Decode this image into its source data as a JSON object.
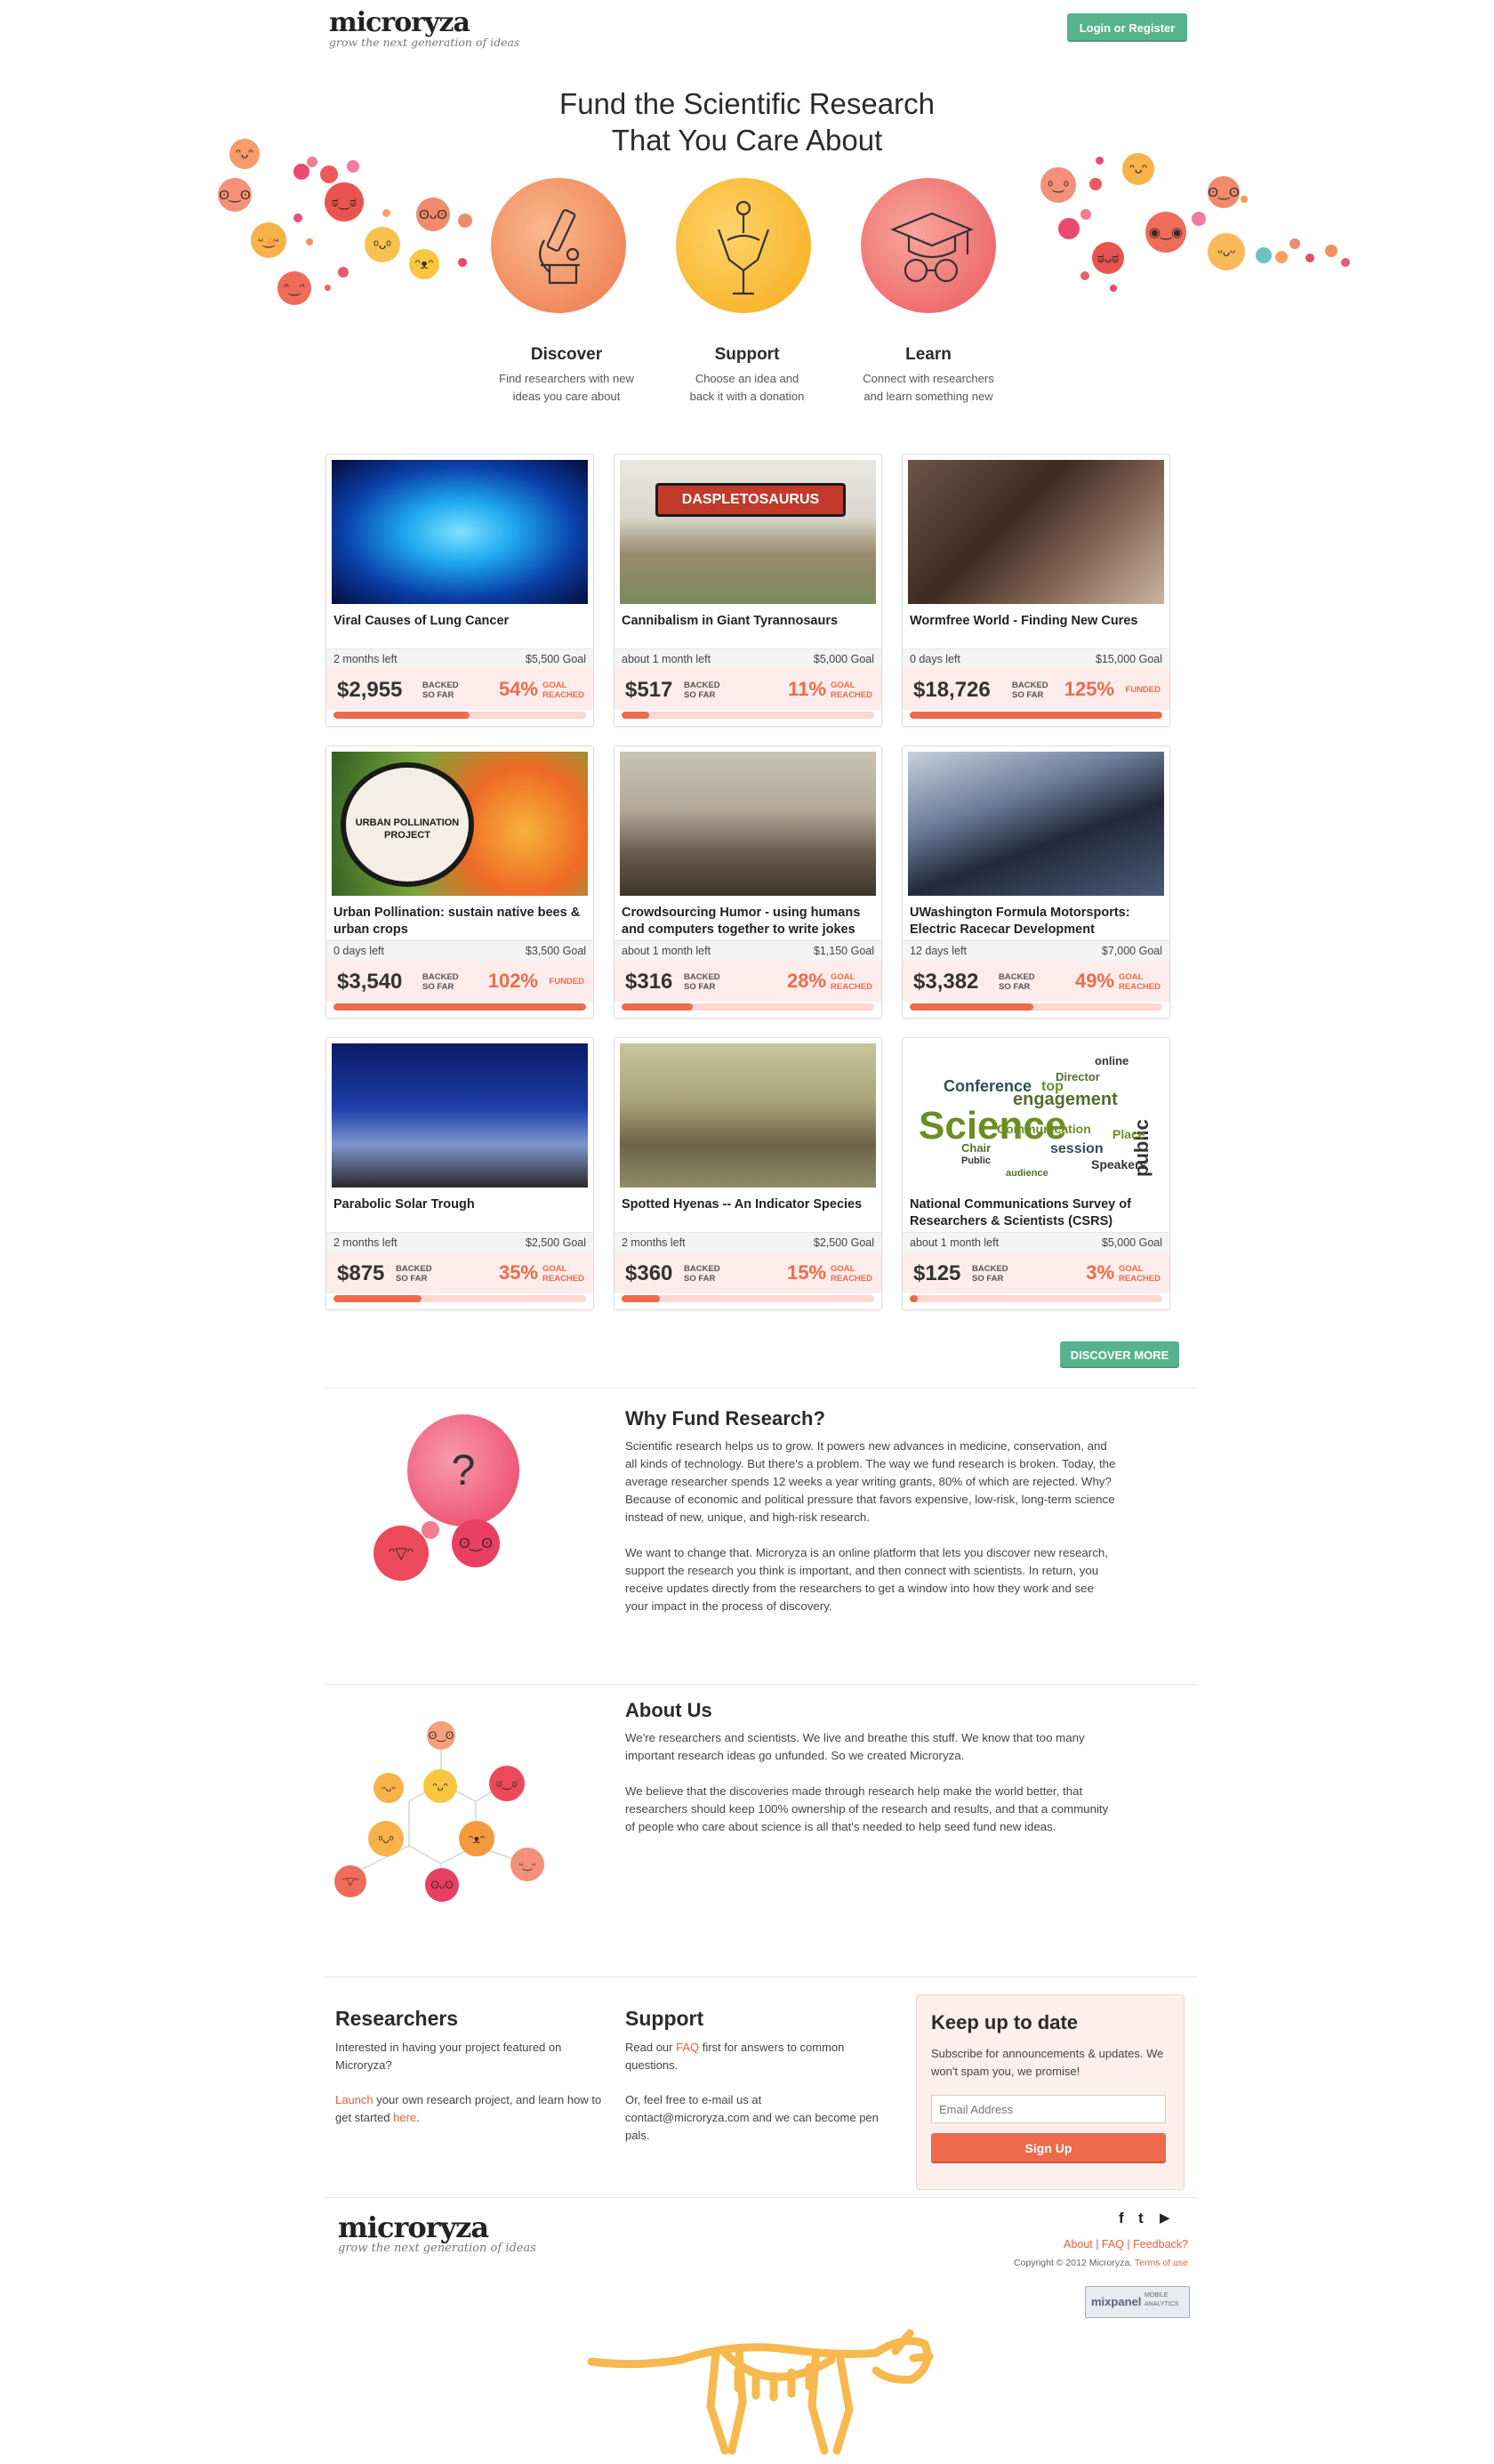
{
  "header": {
    "logo": "microryza",
    "tagline": "grow the next generation of ideas",
    "login_label": "Login or Register"
  },
  "hero": {
    "title_line1": "Fund the Scientific Research",
    "title_line2": "That You Care About"
  },
  "features": [
    {
      "title": "Discover",
      "line1": "Find researchers with new",
      "line2": "ideas you care about",
      "icon": "microscope-icon"
    },
    {
      "title": "Support",
      "line1": "Choose an idea and",
      "line2": "back it with a donation",
      "icon": "hand-icon"
    },
    {
      "title": "Learn",
      "line1": "Connect with researchers",
      "line2": "and learn something new",
      "icon": "graduation-cap-icon"
    }
  ],
  "projects": [
    {
      "title": "Viral Causes of Lung Cancer",
      "time_left": "2 months left",
      "goal": "$5,500 Goal",
      "amount": "$2,955",
      "pct": "54%",
      "status1": "GOAL",
      "status2": "REACHED",
      "progress": 0.54
    },
    {
      "title": "Cannibalism in Giant Tyrannosaurs",
      "time_left": "about 1 month left",
      "goal": "$5,000 Goal",
      "amount": "$517",
      "pct": "11%",
      "status1": "GOAL",
      "status2": "REACHED",
      "progress": 0.11,
      "image_text": "DASPLETOSAURUS"
    },
    {
      "title": "Wormfree World - Finding New Cures",
      "time_left": "0 days left",
      "goal": "$15,000 Goal",
      "amount": "$18,726",
      "pct": "125%",
      "status1": "FUNDED",
      "status2": "",
      "progress": 1.0
    },
    {
      "title": "Urban Pollination: sustain native bees & urban crops",
      "time_left": "0 days left",
      "goal": "$3,500 Goal",
      "amount": "$3,540",
      "pct": "102%",
      "status1": "FUNDED",
      "status2": "",
      "progress": 1.0,
      "image_text": "URBAN POLLINATION PROJECT"
    },
    {
      "title": "Crowdsourcing Humor - using humans and computers together to write jokes",
      "time_left": "about 1 month left",
      "goal": "$1,150 Goal",
      "amount": "$316",
      "pct": "28%",
      "status1": "GOAL",
      "status2": "REACHED",
      "progress": 0.28
    },
    {
      "title": "UWashington Formula Motorsports: Electric Racecar Development",
      "time_left": "12 days left",
      "goal": "$7,000 Goal",
      "amount": "$3,382",
      "pct": "49%",
      "status1": "GOAL",
      "status2": "REACHED",
      "progress": 0.49
    },
    {
      "title": "Parabolic Solar Trough",
      "time_left": "2 months left",
      "goal": "$2,500 Goal",
      "amount": "$875",
      "pct": "35%",
      "status1": "GOAL",
      "status2": "REACHED",
      "progress": 0.35
    },
    {
      "title": "Spotted Hyenas -- An Indicator Species",
      "time_left": "2 months left",
      "goal": "$2,500 Goal",
      "amount": "$360",
      "pct": "15%",
      "status1": "GOAL",
      "status2": "REACHED",
      "progress": 0.15
    },
    {
      "title": "National Communications Survey of Researchers & Scientists (CSRS)",
      "time_left": "about 1 month left",
      "goal": "$5,000 Goal",
      "amount": "$125",
      "pct": "3%",
      "status1": "GOAL",
      "status2": "REACHED",
      "progress": 0.03,
      "image_words": [
        "Science",
        "engagement",
        "Conference",
        "Communication",
        "public",
        "Director",
        "top",
        "online",
        "session",
        "Speakers",
        "Chair",
        "Place",
        "Public",
        "audience"
      ]
    }
  ],
  "backed_line1": "BACKED",
  "backed_line2": "SO FAR",
  "discover_more_label": "DISCOVER MORE",
  "why": {
    "title": "Why Fund Research?",
    "p1": "Scientific research helps us to grow. It powers new advances in medicine, conservation, and all kinds of technology. But there's a problem. The way we fund research is broken. Today, the average researcher spends 12 weeks a year writing grants, 80% of which are rejected. Why? Because of economic and political pressure that favors expensive, low-risk, long-term science instead of new, unique, and high-risk research.",
    "p2": "We want to change that. Microryza is an online platform that lets you discover new research, support the research you think is important, and then connect with scientists. In return, you receive updates directly from the researchers to get a window into how they work and see your impact in the process of discovery."
  },
  "about": {
    "title": "About Us",
    "p1": "We're researchers and scientists. We live and breathe this stuff. We know that too many important research ideas go unfunded. So we created Microryza.",
    "p2": "We believe that the discoveries made through research help make the world better, that researchers should keep 100% ownership of the research and results, and that a community of people who care about science is all that's needed to help seed fund new ideas."
  },
  "researchers": {
    "title": "Researchers",
    "p1": "Interested in having your project featured on Microryza?",
    "link1": "Launch",
    "p2_rest": " your own research project, and learn how to get started ",
    "link2": "here",
    "p2_end": "."
  },
  "support": {
    "title": "Support",
    "p1_start": "Read our ",
    "faq_link": "FAQ",
    "p1_rest": " first for answers to common questions.",
    "p2": "Or, feel free to e-mail us at contact@microryza.com and we can become pen pals."
  },
  "newsletter": {
    "title": "Keep up to date",
    "text": "Subscribe for announcements & updates. We won't spam you, we promise!",
    "email_placeholder": "Email Address",
    "button": "Sign Up"
  },
  "footer": {
    "logo": "microryza",
    "tagline": "grow the next generation of ideas",
    "social": [
      "f",
      "t",
      "▶"
    ],
    "about": "About",
    "faq": "FAQ",
    "feedback": "Feedback?",
    "sep": " | ",
    "copyright": "Copyright © 2012 Microryza.",
    "terms": "Terms of use",
    "mixpanel": "mixpanel",
    "mixpanel_sub1": "MOBILE",
    "mixpanel_sub2": "ANALYTICS"
  },
  "colors": {
    "brand_green": "#57b38c",
    "accent_orange": "#ee6a4c",
    "card_pink": "#fdecea"
  }
}
